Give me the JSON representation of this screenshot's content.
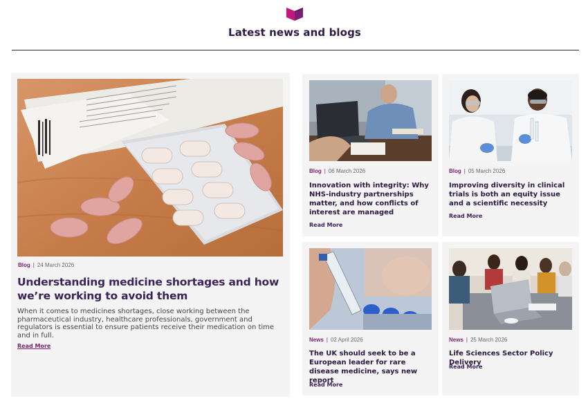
{
  "section": {
    "title": "Latest news and blogs",
    "brand_colors": {
      "purple": "#7b1f72",
      "magenta": "#c2187c",
      "dark": "#2a1840"
    }
  },
  "featured": {
    "category": "Blog",
    "date": "24 March 2026",
    "title": "Understanding medicine shortages and how we’re working to avoid them",
    "excerpt": "When it comes to medicines shortages, close working between the pharmaceutical industry, healthcare professionals, government and regulators is essential to ensure patients receive their medication on time and in full.",
    "read_more": "Read More",
    "image_icon": "pills-blister-photo"
  },
  "cards": [
    {
      "category": "Blog",
      "date": "06 March 2026",
      "title": "Innovation with integrity: Why NHS-industry partnerships matter, and how conflicts of interest are managed",
      "read_more": "Read More",
      "image_icon": "business-meeting-laptop-photo"
    },
    {
      "category": "Blog",
      "date": "05 March 2026",
      "title": "Improving diversity in clinical trials is both an equity issue and a scientific necessity",
      "read_more": "Read More",
      "image_icon": "lab-scientists-photo"
    },
    {
      "category": "News",
      "date": "02 April 2026",
      "title": "The UK should seek to be a European leader for rare disease medicine, says new report",
      "read_more": "Read More",
      "image_icon": "vial-pipette-photo"
    },
    {
      "category": "News",
      "date": "25 March 2026",
      "title": "Life Sciences Sector Policy Delivery",
      "read_more": "Read More",
      "image_icon": "team-meeting-table-photo"
    }
  ]
}
